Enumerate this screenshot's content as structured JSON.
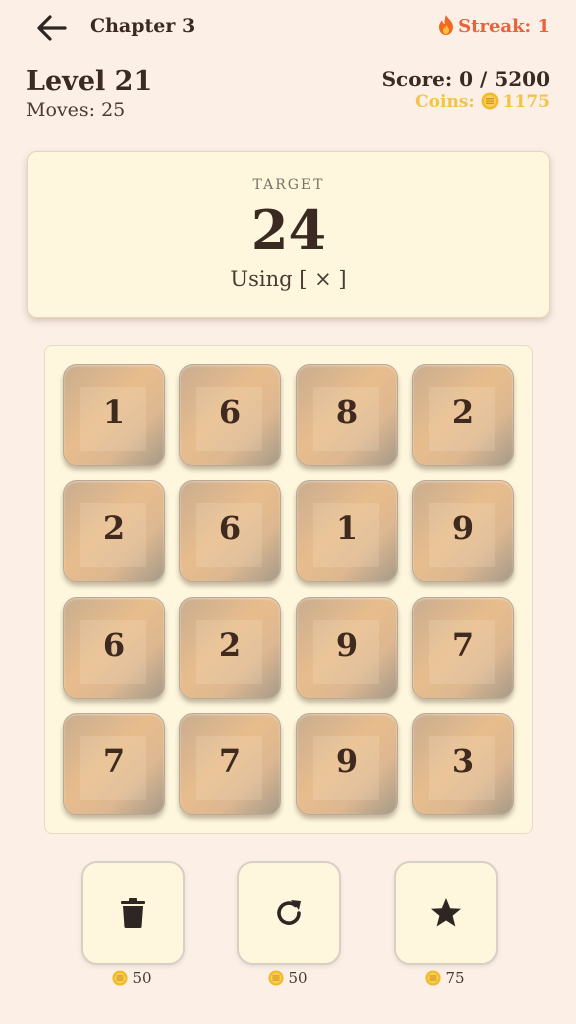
{
  "header": {
    "chapter": "Chapter 3",
    "streak": "Streak: 1"
  },
  "stats": {
    "level": "Level 21",
    "moves": "Moves: 25",
    "score": "Score: 0 / 5200",
    "coins_label": "Coins:",
    "coins_value": "1175"
  },
  "target": {
    "label": "TARGET",
    "value": "24",
    "using": "Using [ × ]"
  },
  "grid": {
    "rows": [
      [
        "1",
        "6",
        "8",
        "2"
      ],
      [
        "2",
        "6",
        "1",
        "9"
      ],
      [
        "6",
        "2",
        "9",
        "7"
      ],
      [
        "7",
        "7",
        "9",
        "3"
      ]
    ]
  },
  "tools": [
    {
      "name": "trash",
      "icon": "trash-icon",
      "cost": "50"
    },
    {
      "name": "refresh",
      "icon": "refresh-icon",
      "cost": "50"
    },
    {
      "name": "star",
      "icon": "star-icon",
      "cost": "75"
    }
  ],
  "colors": {
    "background": "#fbefe6",
    "streak": "#e8623c",
    "coins": "#f4c14a",
    "card": "#fef7dd"
  }
}
